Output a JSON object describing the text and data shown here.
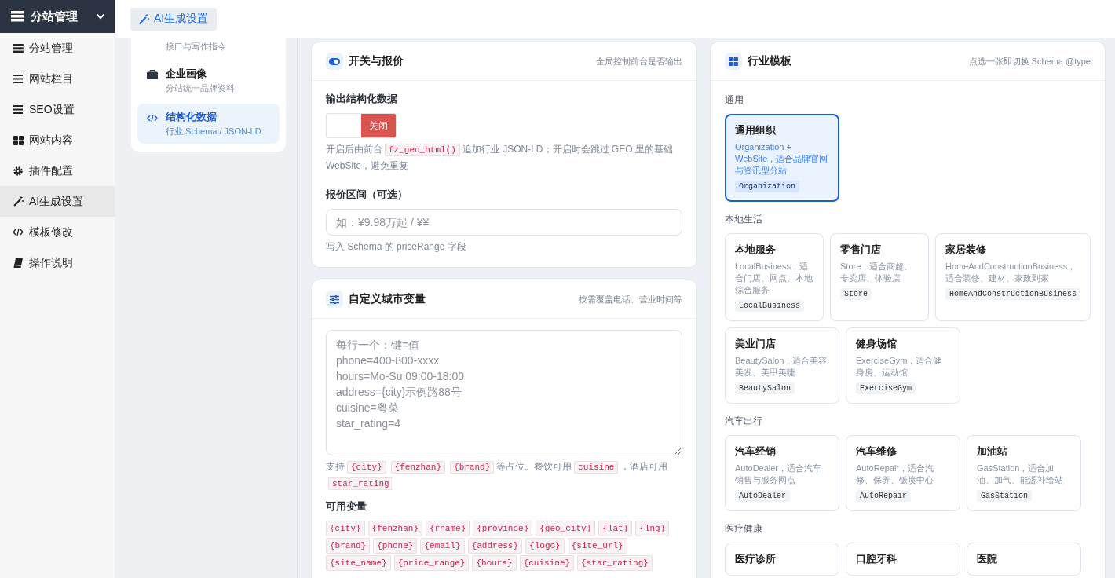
{
  "sidebar": {
    "header": {
      "label": "分站管理",
      "expanded": true
    },
    "items": [
      {
        "label": "分站管理",
        "selected": false
      },
      {
        "label": "网站栏目",
        "selected": false
      },
      {
        "label": "SEO设置",
        "selected": false
      },
      {
        "label": "网站内容",
        "selected": false
      },
      {
        "label": "插件配置",
        "selected": false
      },
      {
        "label": "AI生成设置",
        "selected": true
      },
      {
        "label": "模板修改",
        "selected": false
      },
      {
        "label": "操作说明",
        "selected": false
      }
    ]
  },
  "top_tabs": [
    {
      "label": "AI生成设置",
      "selected": true
    }
  ],
  "section_nav": [
    {
      "subtitle": "接口与写作指令",
      "selected": false
    },
    {
      "title": "企业画像",
      "subtitle": "分站统一品牌资料",
      "selected": false
    },
    {
      "title": "结构化数据",
      "subtitle": "行业 Schema / JSON-LD",
      "selected": true
    }
  ],
  "switch_panel": {
    "title": "开关与报价",
    "hint": "全局控制前台是否输出",
    "output_label": "输出结构化数据",
    "output_switch": {
      "on": false,
      "label": "关闭"
    },
    "output_help": [
      {
        "kind": "text",
        "text": "开启后由前台"
      },
      {
        "kind": "code",
        "text": "fz_geo_html()"
      },
      {
        "kind": "text",
        "text": "追加行业 JSON-LD；开启时会跳过 GEO 里的基础 WebSite，避免重复"
      }
    ],
    "price_label": "报价区间（可选）",
    "price_field": {
      "placeholder": "如：¥9.98万起 / ¥¥"
    },
    "price_help": "写入 Schema 的 priceRange 字段"
  },
  "vars_panel": {
    "title": "自定义城市变量",
    "hint": "按需覆盖电话、营业时间等",
    "field": {
      "placeholder": "每行一个：键=值\nphone=400-800-xxxx\nhours=Mo-Su 09:00-18:00\naddress={city}示例路88号\ncuisine=粤菜\nstar_rating=4"
    },
    "help": [
      {
        "kind": "text",
        "text": "支持"
      },
      {
        "kind": "code",
        "text": "{city}"
      },
      {
        "kind": "code",
        "text": "{fenzhan}"
      },
      {
        "kind": "code",
        "text": "{brand}"
      },
      {
        "kind": "text",
        "text": "等占位。餐饮可用"
      },
      {
        "kind": "code",
        "text": "cuisine"
      },
      {
        "kind": "text",
        "text": "，酒店可用"
      },
      {
        "kind": "code",
        "text": "star_rating"
      }
    ],
    "available_label": "可用变量",
    "variables": [
      "{city}",
      "{fenzhan}",
      "{rname}",
      "{province}",
      "{geo_city}",
      "{lat}",
      "{lng}",
      "{brand}",
      "{phone}",
      "{email}",
      "{address}",
      "{logo}",
      "{site_url}",
      "{site_name}",
      "{price_range}",
      "{hours}",
      "{cuisine}",
      "{star_rating}"
    ]
  },
  "templates_panel": {
    "title": "行业模板",
    "hint": "点选一张即切换 Schema @type",
    "groups": [
      {
        "label": "通用",
        "templates": [
          {
            "title": "通用组织",
            "desc": "Organization + WebSite，适合品牌官网与资讯型分站",
            "type": "Organization",
            "selected": true
          }
        ]
      },
      {
        "label": "本地生活",
        "templates": [
          {
            "title": "本地服务",
            "desc": "LocalBusiness，适合门店、网点、本地综合服务",
            "type": "LocalBusiness",
            "selected": false
          },
          {
            "title": "零售门店",
            "desc": "Store，适合商超、专卖店、体验店",
            "type": "Store",
            "selected": false
          },
          {
            "title": "家居装修",
            "desc": "HomeAndConstructionBusiness，适合装修、建材、家政到家",
            "type": "HomeAndConstructionBusiness",
            "selected": false
          },
          {
            "title": "美业门店",
            "desc": "BeautySalon，适合美容美发、美甲美睫",
            "type": "BeautySalon",
            "selected": false
          },
          {
            "title": "健身场馆",
            "desc": "ExerciseGym，适合健身房、运动馆",
            "type": "ExerciseGym",
            "selected": false
          }
        ]
      },
      {
        "label": "汽车出行",
        "templates": [
          {
            "title": "汽车经销",
            "desc": "AutoDealer，适合汽车销售与服务网点",
            "type": "AutoDealer",
            "selected": false
          },
          {
            "title": "汽车维修",
            "desc": "AutoRepair，适合汽修、保养、钣喷中心",
            "type": "AutoRepair",
            "selected": false
          },
          {
            "title": "加油站",
            "desc": "GasStation，适合加油、加气、能源补给站",
            "type": "GasStation",
            "selected": false
          }
        ]
      },
      {
        "label": "医疗健康",
        "templates": [
          {
            "title": "医疗诊所",
            "selected": false
          },
          {
            "title": "口腔牙科",
            "selected": false
          },
          {
            "title": "医院",
            "selected": false
          }
        ]
      }
    ]
  }
}
